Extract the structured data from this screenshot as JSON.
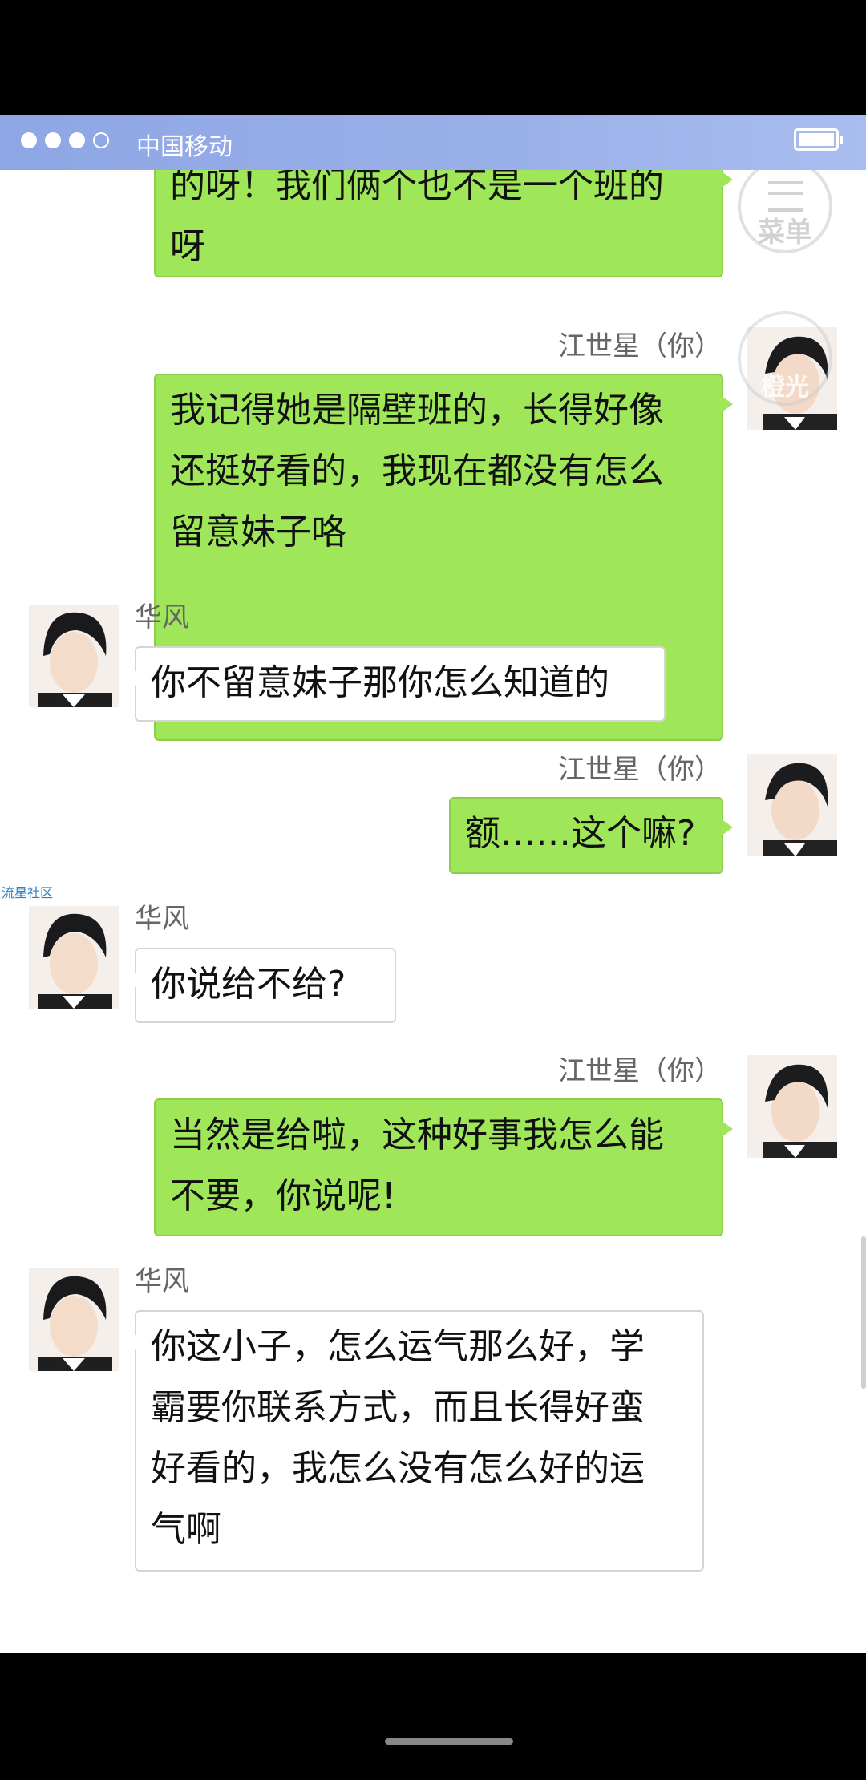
{
  "status_bar": {
    "carrier": "中国移动"
  },
  "watermark": {
    "menu_label": "菜单",
    "logo_label": "橙光"
  },
  "side_label": "流星社区",
  "messages": [
    {
      "sender": "",
      "side": "me",
      "text": "的呀！我们俩个也不是一个班的\n呀"
    },
    {
      "sender": "江世星（你）",
      "side": "me",
      "text": "我记得她是隔壁班的，长得好像\n还挺好看的，我现在都没有怎么\n留意妹子咯"
    },
    {
      "sender": "华风",
      "side": "other",
      "text": "你不留意妹子那你怎么知道的"
    },
    {
      "sender": "江世星（你）",
      "side": "me",
      "text": "额……这个嘛?"
    },
    {
      "sender": "华风",
      "side": "other",
      "text": "你说给不给?"
    },
    {
      "sender": "江世星（你）",
      "side": "me",
      "text": "当然是给啦，这种好事我怎么能\n不要，你说呢!"
    },
    {
      "sender": "华风",
      "side": "other",
      "text": "你这小子，怎么运气那么好，学\n霸要你联系方式，而且长得好蛮\n好看的，我怎么没有怎么好的运\n气啊"
    }
  ]
}
